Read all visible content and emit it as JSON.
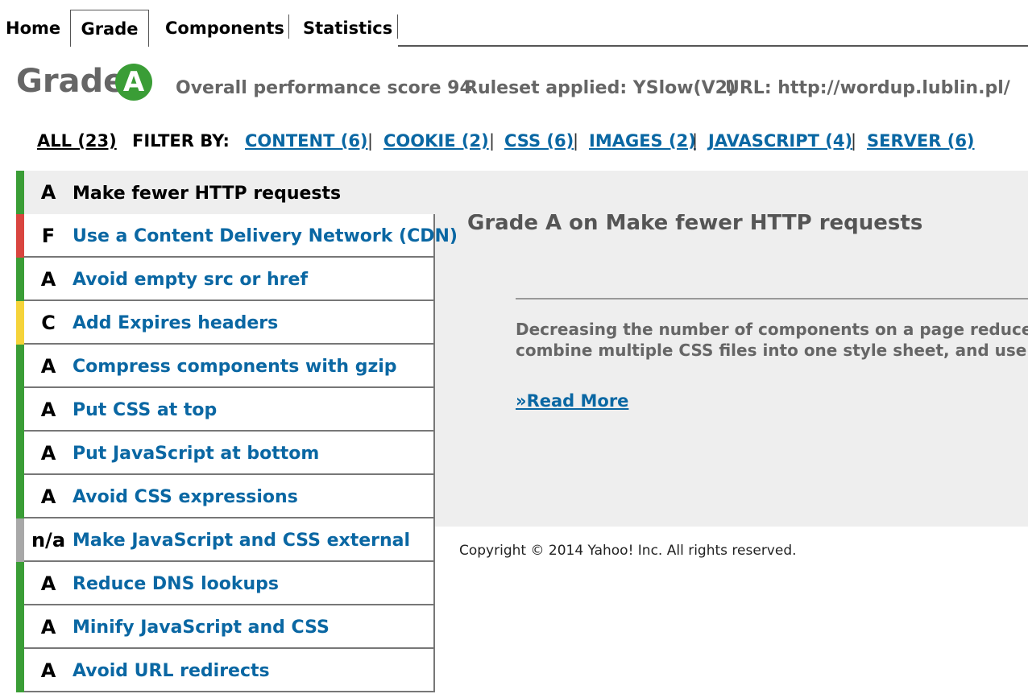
{
  "tabs": {
    "home": "Home",
    "grade": "Grade",
    "components": "Components",
    "statistics": "Statistics"
  },
  "header": {
    "title": "Grade",
    "grade_letter": "A",
    "overall_score": "Overall performance score 94",
    "ruleset": "Ruleset applied: YSlow(V2)",
    "url": "URL: http://wordup.lublin.pl/"
  },
  "filter": {
    "all": "ALL (23)",
    "label": "FILTER BY:",
    "items": [
      "CONTENT (6)",
      "COOKIE (2)",
      "CSS (6)",
      "IMAGES (2)",
      "JAVASCRIPT (4)",
      "SERVER (6)"
    ],
    "separator": "|"
  },
  "colors": {
    "grade_a": "#3a9d36",
    "grade_c": "#f5d33a",
    "grade_f": "#d9453f",
    "grade_na": "#a8a8a8",
    "link": "#0a67a3"
  },
  "rules": [
    {
      "grade": "A",
      "name": "Make fewer HTTP requests",
      "selected": true
    },
    {
      "grade": "F",
      "name": "Use a Content Delivery Network (CDN)"
    },
    {
      "grade": "A",
      "name": "Avoid empty src or href"
    },
    {
      "grade": "C",
      "name": "Add Expires headers"
    },
    {
      "grade": "A",
      "name": "Compress components with gzip"
    },
    {
      "grade": "A",
      "name": "Put CSS at top"
    },
    {
      "grade": "A",
      "name": "Put JavaScript at bottom"
    },
    {
      "grade": "A",
      "name": "Avoid CSS expressions"
    },
    {
      "grade": "n/a",
      "name": "Make JavaScript and CSS external"
    },
    {
      "grade": "A",
      "name": "Reduce DNS lookups"
    },
    {
      "grade": "A",
      "name": "Minify JavaScript and CSS"
    },
    {
      "grade": "A",
      "name": "Avoid URL redirects"
    }
  ],
  "detail": {
    "title": "Grade A on Make fewer HTTP requests",
    "text": "Decreasing the number of components on a page reduce\ncombine multiple CSS files into one style sheet, and use",
    "read_more": "»Read More"
  },
  "footer": {
    "copyright": "Copyright © 2014 Yahoo! Inc. All rights reserved."
  }
}
